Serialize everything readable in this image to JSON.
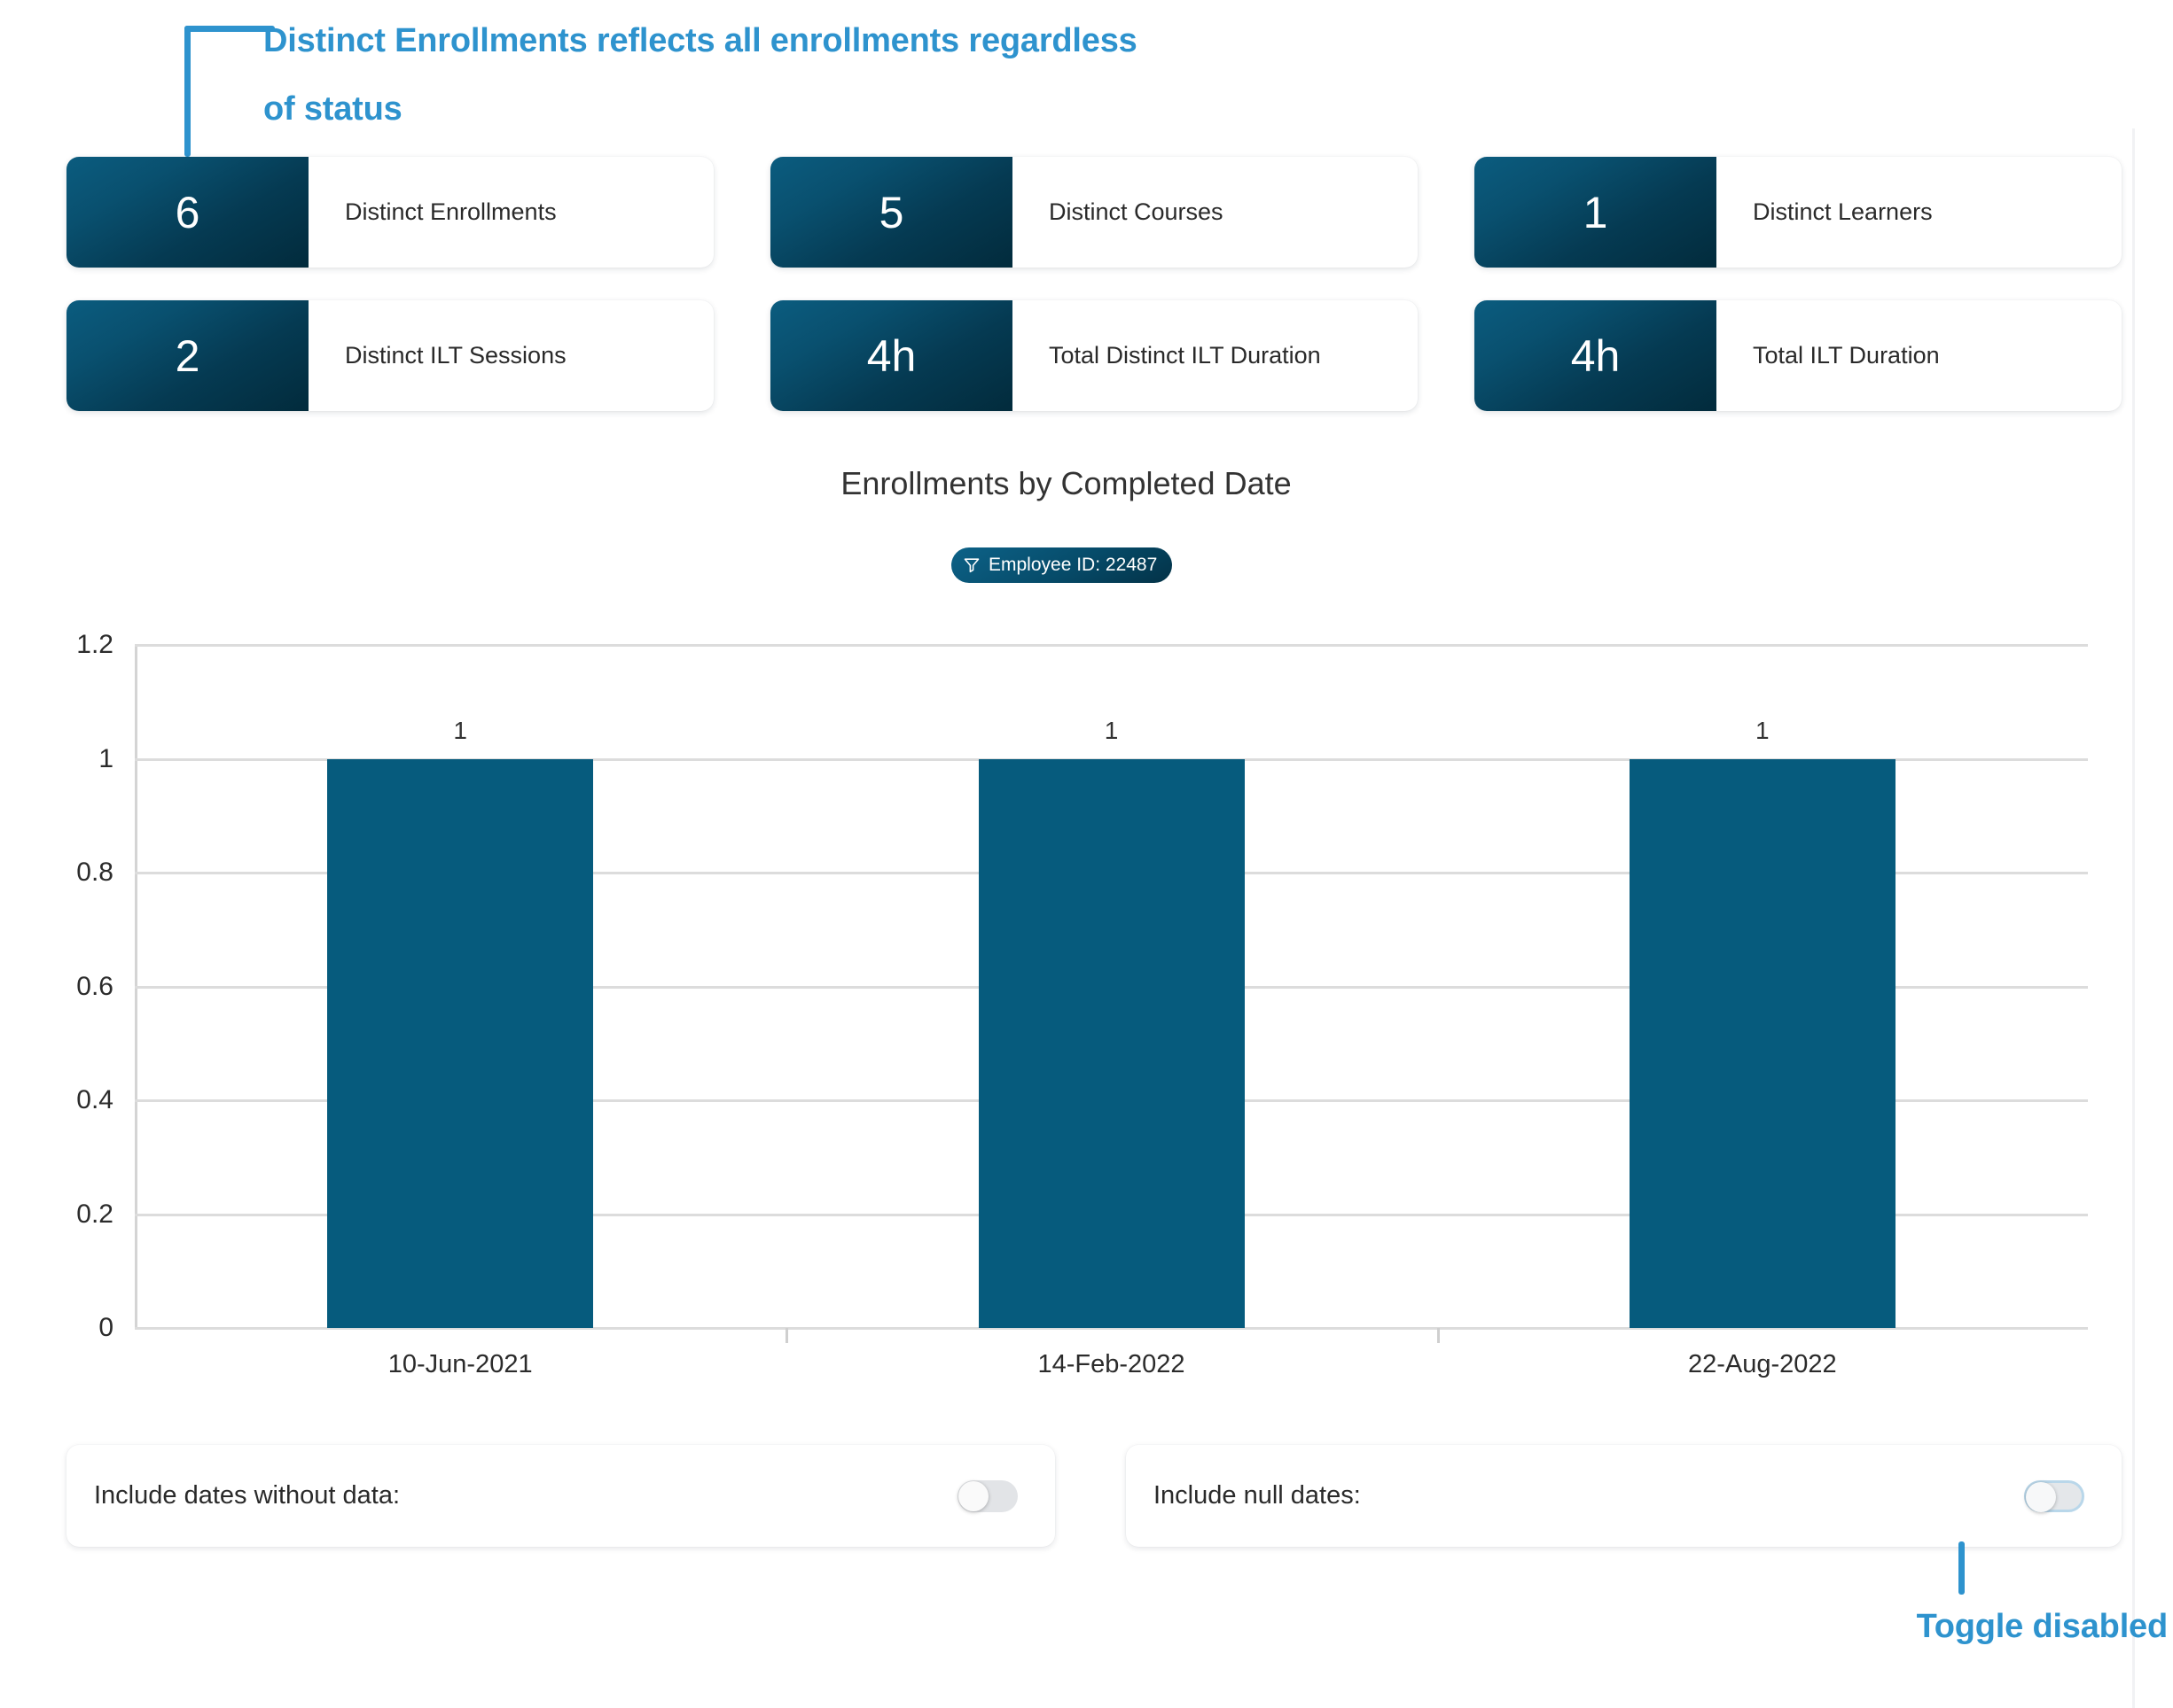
{
  "annotations": {
    "top": "Distinct Enrollments reflects all enrollments regardless of status",
    "bottom": "Toggle disabled",
    "color": "#2e93ce"
  },
  "kpis": [
    {
      "value": "6",
      "label": "Distinct Enrollments"
    },
    {
      "value": "5",
      "label": "Distinct Courses"
    },
    {
      "value": "1",
      "label": "Distinct Learners"
    },
    {
      "value": "2",
      "label": "Distinct ILT Sessions"
    },
    {
      "value": "4h",
      "label": "Total Distinct ILT Duration"
    },
    {
      "value": "4h",
      "label": "Total ILT Duration"
    }
  ],
  "chart_header": {
    "title": "Enrollments by Completed Date",
    "filter_pill": "Employee ID: 22487",
    "filter_icon": "funnel-icon"
  },
  "chart_data": {
    "type": "bar",
    "title": "Enrollments by Completed Date",
    "xlabel": "",
    "ylabel": "",
    "categories": [
      "10-Jun-2021",
      "14-Feb-2022",
      "22-Aug-2022"
    ],
    "values": [
      1,
      1,
      1
    ],
    "data_labels": [
      "1",
      "1",
      "1"
    ],
    "ylim": [
      0,
      1.2
    ],
    "yticks": [
      "0",
      "0.2",
      "0.4",
      "0.6",
      "0.8",
      "1",
      "1.2"
    ],
    "ytick_values": [
      0,
      0.2,
      0.4,
      0.6,
      0.8,
      1,
      1.2
    ],
    "grid": true,
    "legend": "none",
    "bar_color": "#065b7d"
  },
  "toggles": [
    {
      "label": "Include dates without data:",
      "state": "off",
      "disabled": false
    },
    {
      "label": "Include null dates:",
      "state": "off",
      "disabled": true
    }
  ]
}
